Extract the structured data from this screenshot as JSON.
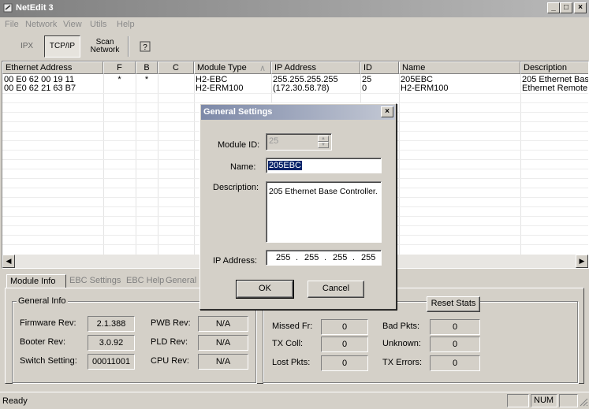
{
  "window": {
    "title": "NetEdit 3",
    "buttons": {
      "minimize": "_",
      "maximize": "□",
      "close": "×"
    }
  },
  "menu": [
    "File",
    "Network",
    "View",
    "Utils",
    "Help"
  ],
  "toolbar": {
    "ipx": "IPX",
    "tcpip": "TCP/IP",
    "scan_line1": "Scan",
    "scan_line2": "Network",
    "help_icon": "question-icon"
  },
  "table": {
    "headers": [
      "Ethernet Address",
      "F",
      "B",
      "C",
      "Module Type",
      "IP Address",
      "ID",
      "Name",
      "Description"
    ],
    "rows": [
      [
        "00 E0 62 00 19 11",
        "*",
        "*",
        "",
        "H2-EBC",
        "255.255.255.255",
        "25",
        "205EBC",
        "205 Ethernet Bas"
      ],
      [
        "00 E0 62 21 63 B7",
        "",
        "",
        "",
        "H2-ERM100",
        "(172.30.58.78)",
        "0",
        "H2-ERM100",
        "Ethernet Remote"
      ]
    ]
  },
  "tabs": [
    "Module Info",
    "EBC Settings",
    "EBC Help",
    "General I"
  ],
  "general_info": {
    "title": "General Info",
    "firmware_label": "Firmware Rev:",
    "firmware": "2.1.388",
    "booter_label": "Booter Rev:",
    "booter": "3.0.92",
    "switch_label": "Switch Setting:",
    "switch": "00011001",
    "pwb_label": "PWB Rev:",
    "pwb": "N/A",
    "pld_label": "PLD Rev:",
    "pld": "N/A",
    "cpu_label": "CPU Rev:",
    "cpu": "N/A"
  },
  "stats": {
    "reset_label": "Reset Stats",
    "missed_label": "Missed Fr:",
    "missed": "0",
    "txcoll_label": "TX Coll:",
    "txcoll": "0",
    "lost_label": "Lost Pkts:",
    "lost": "0",
    "bad_label": "Bad Pkts:",
    "bad": "0",
    "unknown_label": "Unknown:",
    "unknown": "0",
    "txerr_label": "TX Errors:",
    "txerr": "0"
  },
  "status": {
    "text": "Ready",
    "num": "NUM"
  },
  "dialog": {
    "title": "General Settings",
    "close": "×",
    "module_id_label": "Module ID:",
    "module_id": "25",
    "name_label": "Name:",
    "name": "205EBC",
    "description_label": "Description:",
    "description": "205 Ethernet Base Controller.",
    "ip_label": "IP Address:",
    "ip": [
      "255",
      "255",
      "255",
      "255"
    ],
    "ip_sep": ".",
    "ok": "OK",
    "cancel": "Cancel"
  }
}
